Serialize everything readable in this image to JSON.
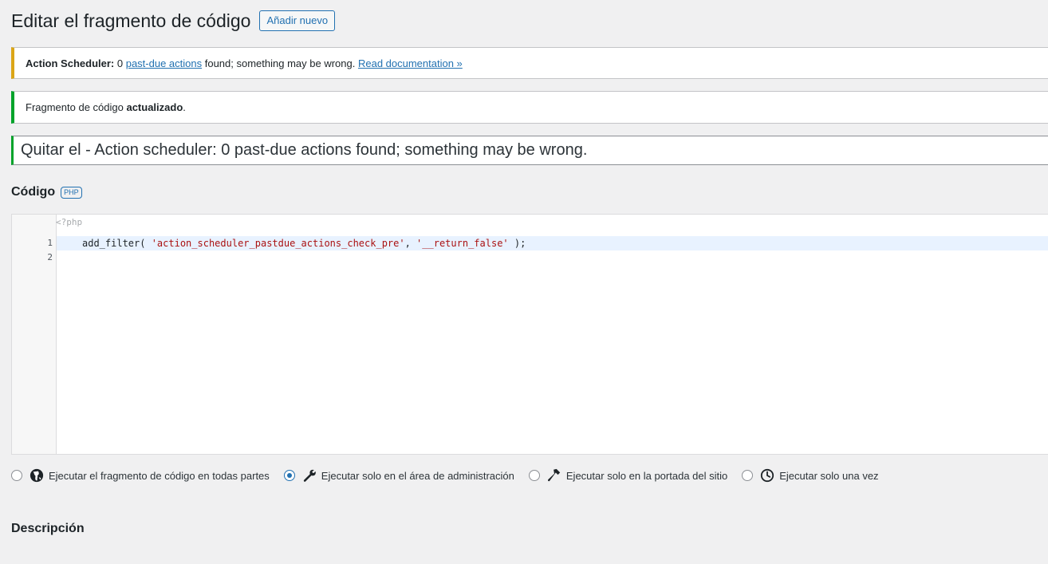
{
  "header": {
    "title": "Editar el fragmento de código",
    "add_new_label": "Añadir nuevo"
  },
  "notices": {
    "warning": {
      "prefix": "Action Scheduler:",
      "count_text": " 0 ",
      "link1": "past-due actions",
      "middle": " found; something may be wrong. ",
      "link2": "Read documentation »"
    },
    "success": {
      "text": "Fragmento de código ",
      "bold": "actualizado",
      "suffix": "."
    }
  },
  "snippet": {
    "name": "Quitar el - Action scheduler: 0 past-due actions found; something may be wrong."
  },
  "code_section": {
    "heading": "Código",
    "badge": "PHP",
    "php_open": "<?php",
    "lines": [
      {
        "number": "1",
        "code_prefix": "add_filter( ",
        "str1": "'action_scheduler_pastdue_actions_check_pre'",
        "sep": ", ",
        "str2": "'__return_false'",
        "suffix": " );"
      },
      {
        "number": "2"
      }
    ]
  },
  "scope_options": [
    {
      "label": "Ejecutar el fragmento de código en todas partes",
      "icon": "globe-icon",
      "checked": false
    },
    {
      "label": "Ejecutar solo en el área de administración",
      "icon": "wrench-icon",
      "checked": true
    },
    {
      "label": "Ejecutar solo en la portada del sitio",
      "icon": "hammer-icon",
      "checked": false
    },
    {
      "label": "Ejecutar solo una vez",
      "icon": "clock-icon",
      "checked": false
    }
  ],
  "description": {
    "heading": "Descripción"
  },
  "colors": {
    "accent": "#2271b1",
    "warning": "#dba617",
    "success": "#00a32a",
    "string": "#aa1111"
  }
}
